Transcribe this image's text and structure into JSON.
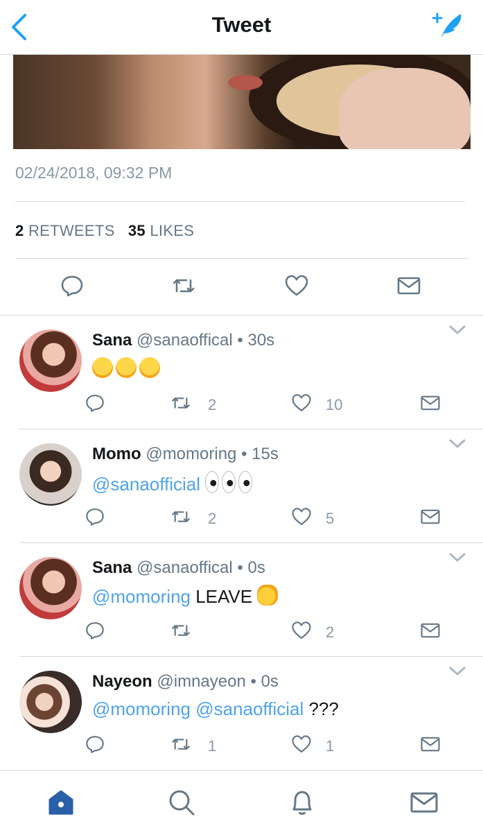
{
  "header": {
    "title": "Tweet",
    "back_icon": "chevron-left-icon",
    "compose_icon": "compose-tweet-icon"
  },
  "main_tweet": {
    "timestamp": "02/24/2018, 09:32 PM",
    "retweets_count": "2",
    "retweets_label": "RETWEETS",
    "likes_count": "35",
    "likes_label": "LIKES"
  },
  "replies": [
    {
      "name": "Sana",
      "handle": "@sanaoffical",
      "time": "30s",
      "body_mentions": [],
      "body_text": "",
      "emoji": [
        "upside-down-face",
        "upside-down-face",
        "upside-down-face"
      ],
      "retweets": "2",
      "likes": "10"
    },
    {
      "name": "Momo",
      "handle": "@momoring",
      "time": "15s",
      "body_mentions": [
        "@sanaofficial"
      ],
      "body_text": "",
      "emoji": [
        "eyes",
        "eyes",
        "eyes"
      ],
      "retweets": "2",
      "likes": "5"
    },
    {
      "name": "Sana",
      "handle": "@sanaoffical",
      "time": "0s",
      "body_mentions": [
        "@momoring"
      ],
      "body_text": "LEAVE",
      "emoji": [
        "clapping-hands"
      ],
      "retweets": "",
      "likes": "2"
    },
    {
      "name": "Nayeon",
      "handle": "@imnayeon",
      "time": "0s",
      "body_mentions": [
        "@momoring",
        "@sanaofficial"
      ],
      "body_text": "???",
      "emoji": [],
      "retweets": "1",
      "likes": "1"
    }
  ],
  "separator_dot": "•",
  "colors": {
    "accent": "#1da1f2",
    "mention": "#4fa3e6",
    "icon_gray": "#657786",
    "nav_active": "#2b5fa8"
  },
  "tab_bar": {
    "items": [
      "home-icon",
      "search-icon",
      "notifications-icon",
      "messages-icon"
    ]
  }
}
